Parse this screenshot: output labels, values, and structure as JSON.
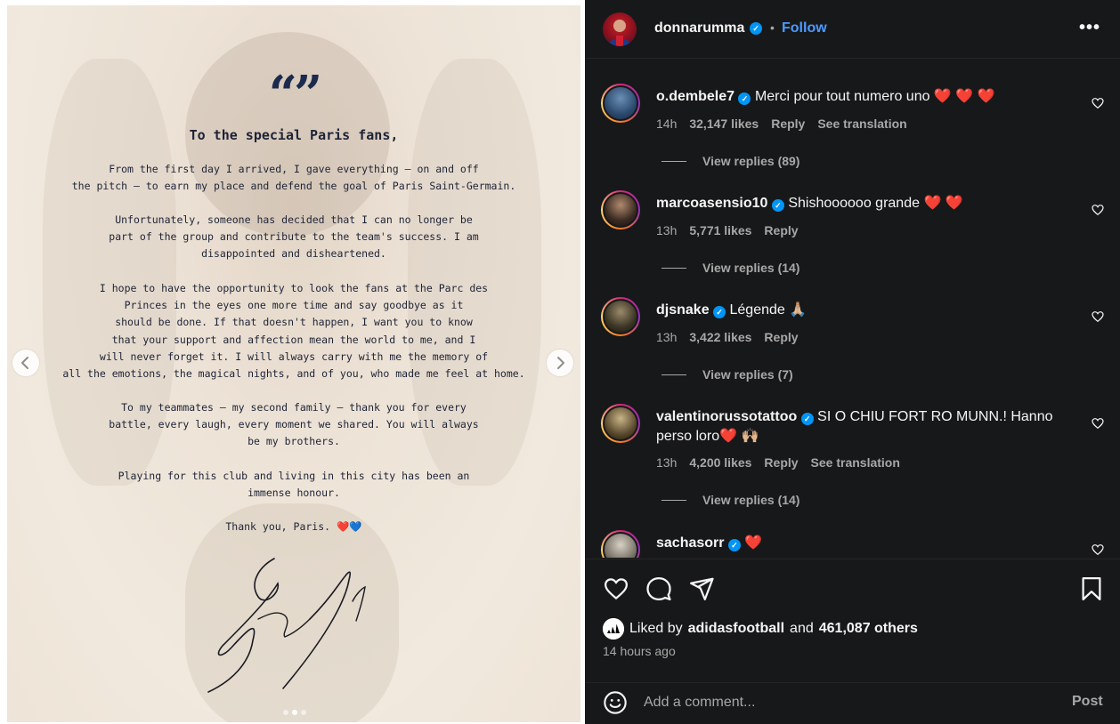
{
  "post": {
    "letter": {
      "quote_mark": "“”",
      "salutation": "To the special Paris fans,",
      "paragraphs": [
        "From the first day I arrived, I gave everything — on and off\nthe pitch — to earn my place and defend the goal of Paris Saint-Germain.",
        "Unfortunately, someone has decided that I can no longer be\npart of the group and contribute to the team's success. I am\ndisappointed and disheartened.",
        "I hope to have the opportunity to look the fans at the Parc des\nPrinces in the eyes one more time and say goodbye as it\nshould be done. If that doesn't happen, I want you to know\nthat your support and affection mean the world to me, and I\nwill never forget it. I will always carry with me the memory of\nall the emotions, the magical nights, and of you, who made me feel at home.",
        "To my teammates — my second family — thank you for every\nbattle, every laugh, every moment we shared. You will always\nbe my brothers.",
        "Playing for this club and living in this city has been an\nimmense honour."
      ],
      "closing": "Thank you, Paris. ❤️💙"
    },
    "carousel": {
      "prev_icon": "chevron-left-icon",
      "next_icon": "chevron-right-icon",
      "slide_count": 3,
      "active_slide": 2
    }
  },
  "header": {
    "username": "donnarumma",
    "separator": "•",
    "follow_label": "Follow",
    "more_icon": "more-horizontal-icon",
    "more_label": "•••"
  },
  "comments": [
    {
      "username": "o.dembele7",
      "text": "Merci pour tout numero uno ❤️ ❤️ ❤️",
      "time": "14h",
      "likes": "32,147 likes",
      "reply_label": "Reply",
      "translation_label": "See translation",
      "view_replies": "View replies (89)"
    },
    {
      "username": "marcoasensio10",
      "text": "Shishoooooo grande ❤️ ❤️",
      "time": "13h",
      "likes": "5,771 likes",
      "reply_label": "Reply",
      "view_replies": "View replies (14)"
    },
    {
      "username": "djsnake",
      "text": "Légende 🙏🏼",
      "time": "13h",
      "likes": "3,422 likes",
      "reply_label": "Reply",
      "view_replies": "View replies (7)"
    },
    {
      "username": "valentinorussotattoo",
      "text": "SI O CHIU FORT RO MUNN.! Hanno perso loro❤️ 🙌🏼",
      "time": "13h",
      "likes": "4,200 likes",
      "reply_label": "Reply",
      "translation_label": "See translation",
      "view_replies": "View replies (14)"
    },
    {
      "username": "sachasorr",
      "text": "❤️"
    }
  ],
  "actions": {
    "like_icon": "heart-icon",
    "comment_icon": "comment-icon",
    "share_icon": "share-icon",
    "save_icon": "bookmark-icon",
    "liked_by_prefix": "Liked by",
    "liked_by_user": "adidasfootball",
    "liked_by_and": "and",
    "liked_by_others": "461,087 others",
    "time_ago": "14 hours ago"
  },
  "composer": {
    "emoji_icon": "smiley-icon",
    "placeholder": "Add a comment...",
    "post_label": "Post"
  },
  "colors": {
    "panel_bg": "#17181a",
    "accent_blue": "#4b9bff",
    "verified_blue": "#0095f6",
    "muted_text": "#a8a8a8",
    "letter_ink": "#1d2336"
  }
}
